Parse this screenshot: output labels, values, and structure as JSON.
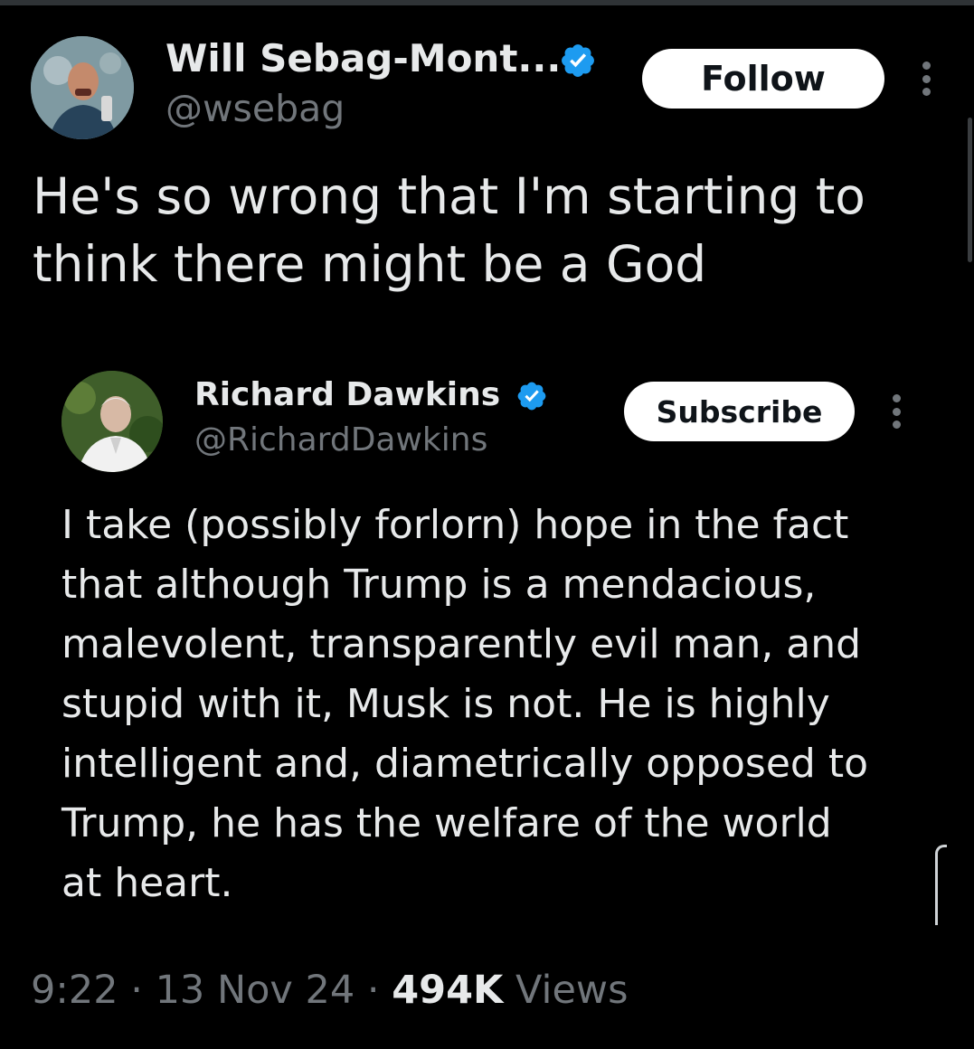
{
  "tweet": {
    "author": {
      "display_name": "Will Sebag-Mont...",
      "handle": "@wsebag",
      "verified_icon": "verified-badge-icon",
      "avatar": "avatar"
    },
    "follow_label": "Follow",
    "more_icon": "more-options-icon",
    "text": "He's so wrong that I'm starting to think there might be a God",
    "timestamp": "9:22 · 13 Nov 24 · ",
    "views_count": "494K",
    "views_label": "Views"
  },
  "quoted_tweet": {
    "author": {
      "display_name": "Richard Dawkins",
      "handle": "@RichardDawkins",
      "verified_icon": "verified-badge-icon",
      "avatar": "avatar"
    },
    "subscribe_label": "Subscribe",
    "more_icon": "more-options-icon",
    "lines": [
      "I take  (possibly forlorn) hope in the fact",
      "that although Trump is a mendacious,",
      "malevolent,  transparently evil man, and",
      "stupid with it, Musk is not. He is highly",
      "intelligent and, diametrically opposed to",
      "Trump, he has the welfare of the world",
      "at heart."
    ]
  },
  "colors": {
    "background": "#000000",
    "text_primary": "#e7e9ea",
    "text_secondary": "#71767b",
    "verified_blue": "#1d9bf0",
    "button_bg": "#ffffff"
  }
}
